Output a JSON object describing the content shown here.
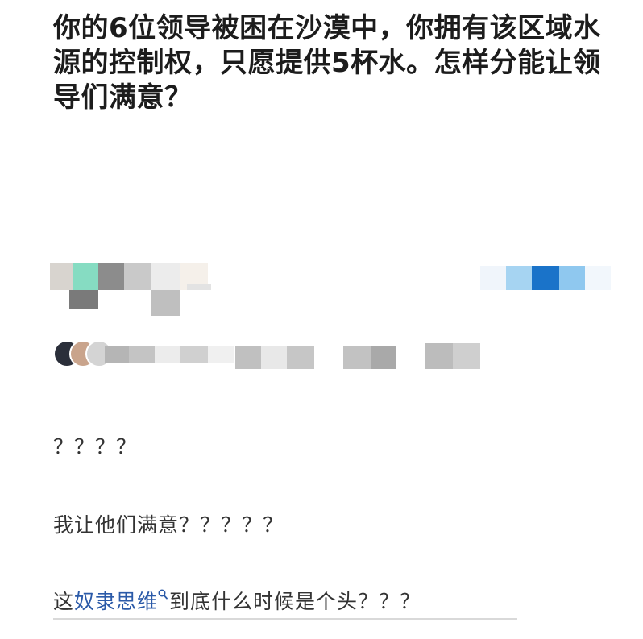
{
  "post": {
    "question": "你的6位领导被困在沙漠中，你拥有该区域水源的控制权，只愿提供5杯水。怎样分能让领导们满意？"
  },
  "comments": [
    {
      "text": "？？？？"
    },
    {
      "text": "我让他们满意？？？？？"
    }
  ],
  "search_comment": {
    "keyword": "奴隶思维",
    "before": "这",
    "after": "到底什么时候是个头？？？",
    "keyword_icon": "search-icon",
    "keyword_color": "#2b5aa8"
  },
  "colors": {
    "mosaic_accent_green": "#7fd8bd",
    "mosaic_accent_blue": "#1a73c9",
    "mosaic_gray": "#8a8a8a"
  }
}
